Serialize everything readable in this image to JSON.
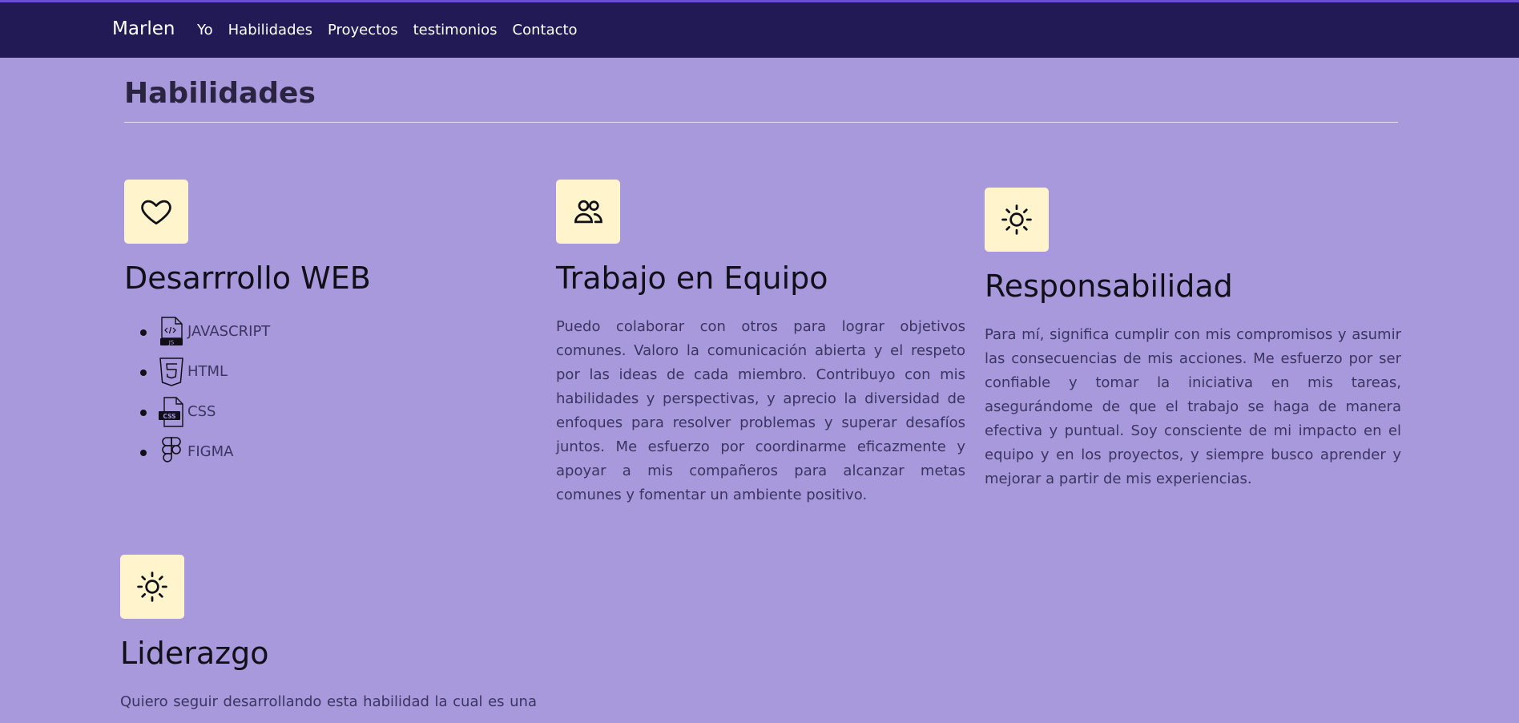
{
  "navbar": {
    "brand": "Marlen",
    "links": [
      "Yo",
      "Habilidades",
      "Proyectos",
      "testimonios",
      "Contacto"
    ]
  },
  "section": {
    "title": "Habilidades"
  },
  "cards": {
    "web": {
      "icon": "heart-icon",
      "title": "Desarrrollo WEB",
      "skills": [
        {
          "label": "JAVASCRIPT",
          "icon": "javascript-file-icon"
        },
        {
          "label": "HTML",
          "icon": "html5-icon"
        },
        {
          "label": "CSS",
          "icon": "css-file-icon"
        },
        {
          "label": "FIGMA",
          "icon": "figma-icon"
        }
      ]
    },
    "team": {
      "icon": "users-icon",
      "title": "Trabajo en Equipo",
      "text": "Puedo colaborar con otros para lograr objetivos comunes. Valoro la comunicación abierta y el respeto por las ideas de cada miembro. Contribuyo con mis habilidades y perspectivas, y aprecio la diversidad de enfoques para resolver problemas y superar desafíos juntos. Me esfuerzo por coordinarme eficazmente y apoyar a mis compañeros para alcanzar metas comunes y fomentar un ambiente positivo."
    },
    "responsibility": {
      "icon": "sun-icon",
      "title": "Responsabilidad",
      "text": "Para mí, significa cumplir con mis compromisos y asumir las consecuencias de mis acciones. Me esfuerzo por ser confiable y tomar la iniciativa en mis tareas, asegurándome de que el trabajo se haga de manera efectiva y puntual. Soy consciente de mi impacto en el equipo y en los proyectos, y siempre busco aprender y mejorar a partir de mis experiencias."
    },
    "leadership": {
      "icon": "sun-icon",
      "title": "Liderazgo",
      "text": "Quiero seguir desarrollando esta habilidad la cual es una"
    }
  },
  "colors": {
    "page_background": "#a898dc",
    "navbar_background": "#221a54",
    "icon_box_background": "#fff4cc"
  }
}
